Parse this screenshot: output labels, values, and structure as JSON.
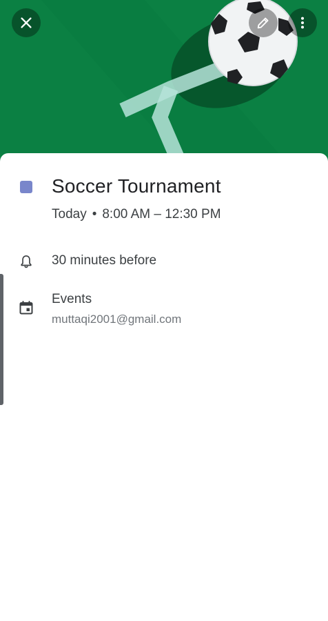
{
  "event": {
    "title": "Soccer Tournament",
    "day": "Today",
    "separator": "•",
    "time_range": "8:00 AM – 12:30 PM",
    "color": "#7986cb"
  },
  "reminder": {
    "text": "30 minutes before",
    "icon": "bell-icon"
  },
  "calendar": {
    "name": "Events",
    "account": "muttaqi2001@gmail.com",
    "icon": "calendar-icon"
  },
  "header": {
    "background_color": "#0b8043",
    "illustration": "soccer-ball-icon",
    "buttons": [
      "close-icon",
      "edit-icon",
      "more-vert-icon"
    ]
  }
}
